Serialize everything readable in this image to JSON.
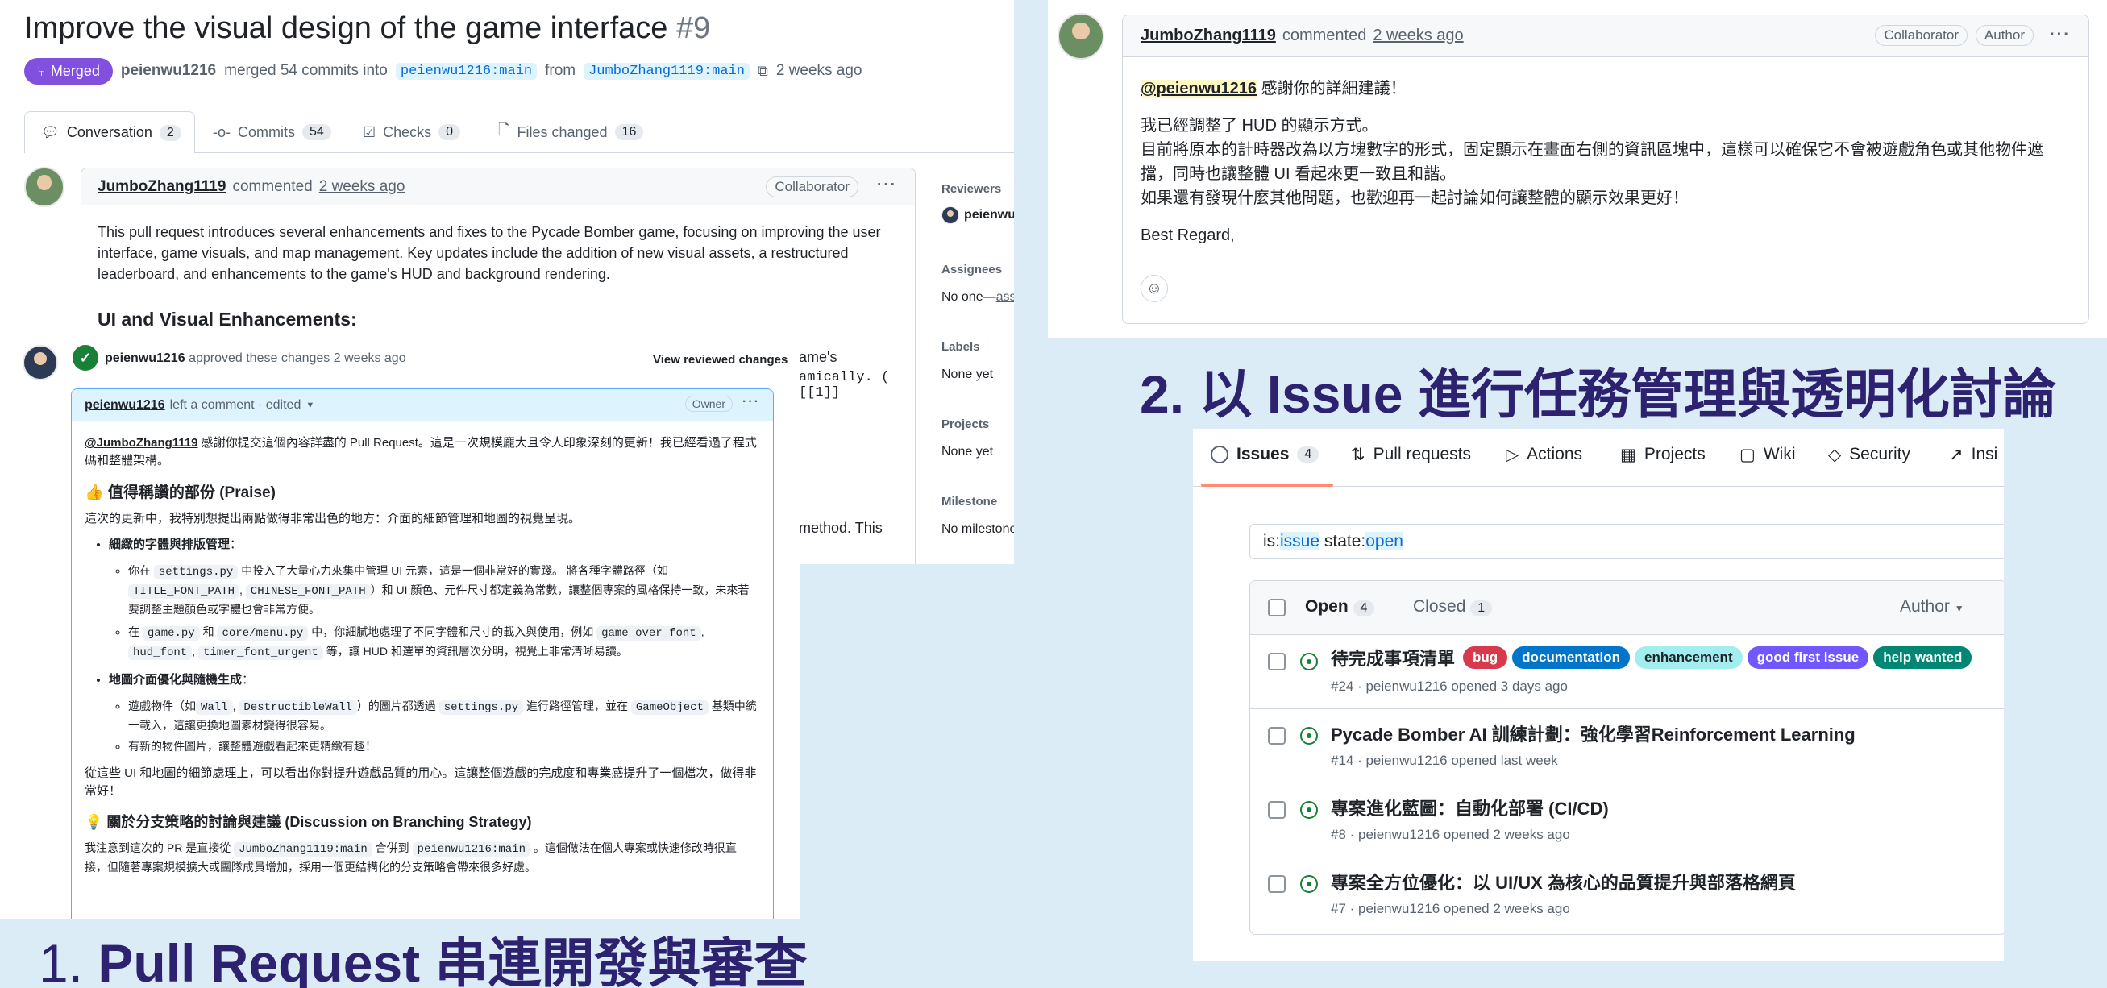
{
  "pr": {
    "title": "Improve the visual design of the game interface",
    "number": "#9",
    "badge": "Merged",
    "summary_user": "peienwu1216",
    "summary_mid": "merged 54 commits into",
    "base_branch": "peienwu1216:main",
    "from_word": "from",
    "head_branch": "JumboZhang1119:main",
    "time": "2 weeks ago",
    "tabs": [
      {
        "label": "Conversation",
        "count": "2"
      },
      {
        "label": "Commits",
        "count": "54"
      },
      {
        "label": "Checks",
        "count": "0"
      },
      {
        "label": "Files changed",
        "count": "16"
      }
    ],
    "comment": {
      "author": "JumboZhang1119",
      "verb": "commented",
      "time": "2 weeks ago",
      "badge": "Collaborator",
      "body": "This pull request introduces several enhancements and fixes to the Pycade Bomber game, focusing on improving the user interface, game visuals, and map management. Key updates include the addition of new visual assets, a restructured leaderboard, and enhancements to the game's HUD and background rendering.",
      "heading": "UI and Visual Enhancements:",
      "frag1": "ame's",
      "frag2": "amically. ( [[1]]",
      "frag3": "method. This"
    },
    "sidebar": {
      "reviewers_label": "Reviewers",
      "reviewer": "peienwu",
      "assignees_label": "Assignees",
      "assignees_value": "No one—",
      "assignees_link": "assi",
      "labels_label": "Labels",
      "labels_value": "None yet",
      "projects_label": "Projects",
      "projects_value": "None yet",
      "milestone_label": "Milestone",
      "milestone_value": "No milestone"
    },
    "review": {
      "user": "peienwu1216",
      "text": "approved these changes",
      "time": "2 weeks ago",
      "action": "View reviewed changes"
    },
    "inner": {
      "user": "peienwu1216",
      "meta": "left a comment · edited",
      "badge": "Owner",
      "mention": "@JumboZhang1119",
      "intro": "感謝你提交這個內容詳盡的 Pull Request。這是一次規模龐大且令人印象深刻的更新！我已經看過了程式碼和整體架構。",
      "praise_heading": "👍 值得稱讚的部份 (Praise)",
      "praise_intro": "這次的更新中，我特別想提出兩點做得非常出色的地方：介面的細節管理和地圖的視覺呈現。",
      "b1_title": "細緻的字體與排版管理",
      "b1_s1_a": "你在",
      "b1_s1_code1": "settings.py",
      "b1_s1_b": "中投入了大量心力來集中管理 UI 元素，這是一個非常好的實踐。 將各種字體路徑（如",
      "b1_s1_code2": "TITLE_FONT_PATH",
      "b1_s1_code3": "CHINESE_FONT_PATH",
      "b1_s1_c": "）和 UI 顏色、元件尺寸都定義為常數，讓整個專案的風格保持一致，未來若要調整主題顏色或字體也會非常方便。",
      "b1_s2_a": "在",
      "b1_s2_code1": "game.py",
      "b1_s2_and": "和",
      "b1_s2_code2": "core/menu.py",
      "b1_s2_b": "中，你細膩地處理了不同字體和尺寸的載入與使用，例如",
      "b1_s2_code3": "game_over_font",
      "b1_s2_code4": "hud_font",
      "b1_s2_code5": "timer_font_urgent",
      "b1_s2_c": "等，讓 HUD 和選單的資訊層次分明，視覺上非常清晰易讀。",
      "b2_title": "地圖介面優化與隨機生成",
      "b2_s1_a": "遊戲物件（如",
      "b2_s1_code1": "Wall",
      "b2_s1_code2": "DestructibleWall",
      "b2_s1_b": "）的圖片都透過",
      "b2_s1_code3": "settings.py",
      "b2_s1_c": "進行路徑管理，並在",
      "b2_s1_code4": "GameObject",
      "b2_s1_d": "基類中統一載入，這讓更換地圖素材變得很容易。",
      "b2_s2": "有新的物件圖片，讓整體遊戲看起來更精緻有趣！",
      "conclusion": "從這些 UI 和地圖的細節處理上，可以看出你對提升遊戲品質的用心。這讓整個遊戲的完成度和專業感提升了一個檔次，做得非常好！",
      "disc_heading": "💡 關於分支策略的討論與建議 (Discussion on Branching Strategy)",
      "disc_a": "我注意到這次的 PR 是直接從",
      "disc_code1": "JumboZhang1119:main",
      "disc_b": "合併到",
      "disc_code2": "peienwu1216:main",
      "disc_c": "。這個做法在個人專案或快速修改時很直接，但隨著專案規模擴大或團隊成員增加，採用一個更結構化的分支策略會帶來很多好處。"
    }
  },
  "issue_comment": {
    "author": "JumboZhang1119",
    "verb": "commented",
    "time": "2 weeks ago",
    "badge1": "Collaborator",
    "badge2": "Author",
    "mention": "@peienwu1216",
    "line1": "感謝你的詳細建議！",
    "line2": "我已經調整了 HUD 的顯示方式。",
    "line3": "目前將原本的計時器改為以方塊數字的形式，固定顯示在畫面右側的資訊區塊中，這樣可以確保它不會被遊戲角色或其他物件遮",
    "line4": "擋，同時也讓整體 UI 看起來更一致且和諧。",
    "line5": "如果還有發現什麼其他問題，也歡迎再一起討論如何讓整體的顯示效果更好！",
    "line6": "Best Regard,"
  },
  "captions": {
    "one_num": "1.",
    "one_text": "Pull Request 串連開發與審查",
    "two": "2. 以 Issue 進行任務管理與透明化討論"
  },
  "issues": {
    "nav": [
      {
        "label": "Issues",
        "count": "4"
      },
      {
        "label": "Pull requests"
      },
      {
        "label": "Actions"
      },
      {
        "label": "Projects"
      },
      {
        "label": "Wiki"
      },
      {
        "label": "Security"
      },
      {
        "label": "Insi"
      }
    ],
    "search_prefix": "is:",
    "search_k1": "issue",
    "search_mid": " state:",
    "search_k2": "open",
    "open_label": "Open",
    "open_count": "4",
    "closed_label": "Closed",
    "closed_count": "1",
    "author_filter": "Author",
    "list": [
      {
        "title": "待完成事項清單",
        "meta": "#24 · peienwu1216 opened 3 days ago"
      },
      {
        "title": "Pycade Bomber AI 訓練計劃：強化學習Reinforcement Learning",
        "meta": "#14 · peienwu1216 opened last week"
      },
      {
        "title": "專案進化藍圖：自動化部署 (CI/CD)",
        "meta": "#8 · peienwu1216 opened 2 weeks ago"
      },
      {
        "title": "專案全方位優化：以 UI/UX 為核心的品質提升與部落格網頁",
        "meta": "#7 · peienwu1216 opened 2 weeks ago"
      }
    ],
    "labels": [
      {
        "name": "bug",
        "color": "#d73a4a"
      },
      {
        "name": "documentation",
        "color": "#0075ca"
      },
      {
        "name": "enhancement",
        "color": "#a2eeef"
      },
      {
        "name": "good first issue",
        "color": "#7057ff"
      },
      {
        "name": "help wanted",
        "color": "#008672"
      }
    ]
  },
  "colors": {
    "background": "#dcecf7",
    "merged": "#8250df",
    "caption": "#2d2270",
    "link_blue": "#0969da",
    "open_green": "#1a7f37"
  }
}
